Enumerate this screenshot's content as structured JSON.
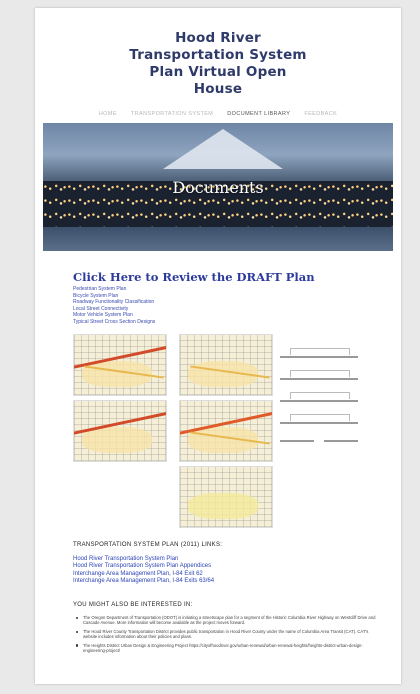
{
  "header": {
    "title_lines": [
      "Hood River",
      "Transportation System",
      "Plan Virtual Open",
      "House"
    ]
  },
  "nav": {
    "items": [
      {
        "label": "Home",
        "active": false
      },
      {
        "label": "Transportation System",
        "active": false
      },
      {
        "label": "Document Library",
        "active": true
      },
      {
        "label": "Feedback",
        "active": false
      }
    ]
  },
  "hero": {
    "heading": "Documents"
  },
  "draft_link": "Click Here to Review the DRAFT Plan",
  "plan_links": [
    "Pedestrian System Plan",
    "Bicycle System Plan",
    "Roadway Functionality Classification",
    "Local Street Connectivity",
    "Motor Vehicle System Plan",
    "Typical Street Cross Section Designs"
  ],
  "tsp_section": {
    "heading": "TRANSPORTATION SYSTEM PLAN (2011) LINKS:",
    "links": [
      "Hood River Transportation System Plan",
      "Hood River Transportation System Plan Appendices",
      "Interchange Area Management Plan, I-84 Exit 62",
      "Interchange Area Management Plan, I-84 Exits 63/64"
    ]
  },
  "interest_section": {
    "heading": "YOU MIGHT ALSO BE INTERESTED IN:",
    "bullets": [
      "The Oregon Department of Transportation (ODOT) is initiating a streetscape plan for a segment of the Historic Columbia River Highway on Westcliff Drive and Cascade Avenue. More information will become available as the project moves forward.",
      "The Hood River County Transportation District provides public transportation in Hood River County under the name of Columbia Area Transit (CAT). CAT's website includes information about their policies and plans.",
      "The Heights District Urban Design & Engineering Project https://cityofhoodriver.gov/urban-renewal/urban-renewal-heights/heights-district-urban-design-engineering-project/"
    ]
  }
}
